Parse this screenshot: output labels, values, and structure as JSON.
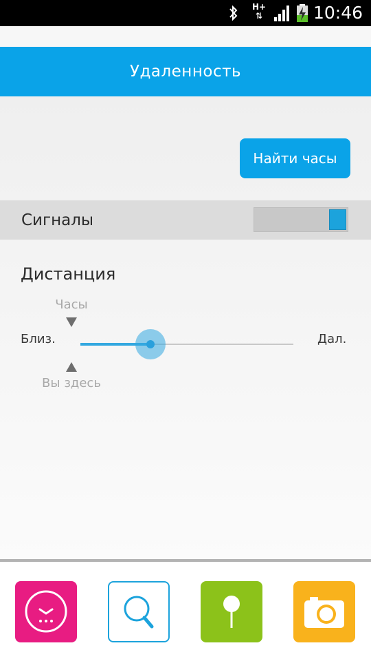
{
  "status_bar": {
    "network_type": "H+",
    "time": "10:46"
  },
  "header": {
    "title": "Удаленность"
  },
  "main": {
    "find_button_label": "Найти часы",
    "signals": {
      "label": "Сигналы",
      "enabled": true
    },
    "distance": {
      "title": "Дистанция",
      "watch_label": "Часы",
      "you_label": "Вы здесь",
      "near_label": "Близ.",
      "far_label": "Дал.",
      "slider_value_fraction": 0.33
    }
  },
  "bottom_nav": {
    "items": [
      {
        "icon": "clock-icon",
        "color": "#e81c82"
      },
      {
        "icon": "search-icon",
        "color": "#1ca3dc"
      },
      {
        "icon": "pin-icon",
        "color": "#8cc21a"
      },
      {
        "icon": "camera-icon",
        "color": "#f9b21c"
      }
    ]
  },
  "colors": {
    "accent": "#0aa3e8",
    "toggle_on": "#1ca3dc"
  }
}
